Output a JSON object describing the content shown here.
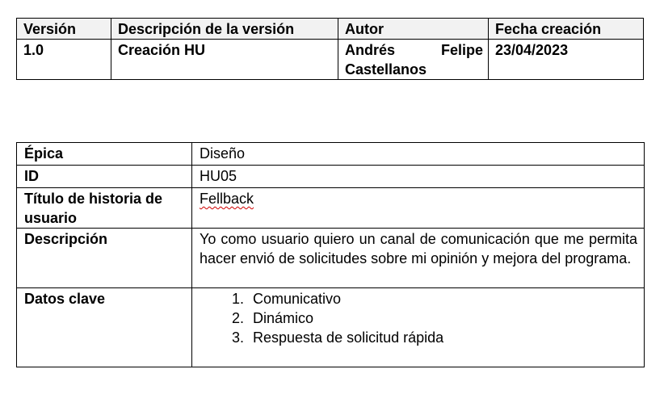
{
  "version_table": {
    "headers": [
      "Versión",
      "Descripción de la versión",
      "Autor",
      "Fecha creación"
    ],
    "rows": [
      {
        "version": "1.0",
        "description": "Creación HU",
        "author": "Andrés Felipe Castellanos",
        "date": "23/04/2023"
      }
    ]
  },
  "story_table": {
    "epic_label": "Épica",
    "epic_value": "Diseño",
    "id_label": "ID",
    "id_value": "HU05",
    "title_label": "Título de historia de usuario",
    "title_value": "Fellback",
    "description_label": "Descripción",
    "description_value": "Yo como usuario quiero un canal de comunicación que me permita hacer envió de solicitudes sobre mi opinión y mejora del programa.",
    "key_data_label": "Datos clave",
    "key_data": [
      "Comunicativo",
      "Dinámico",
      "Respuesta de solicitud rápida"
    ]
  }
}
